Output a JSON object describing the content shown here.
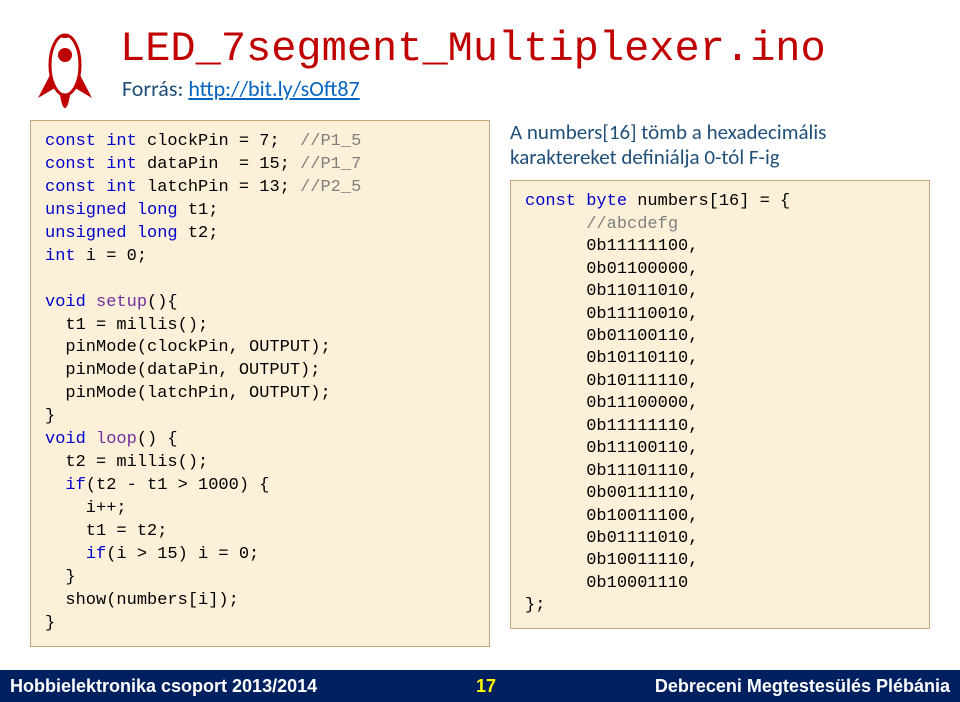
{
  "header": {
    "title": "LED_7segment_Multiplexer.ino",
    "source_label": "Forrás: ",
    "source_link": "http://bit.ly/sOft87"
  },
  "code_left": {
    "l1a": "const int",
    "l1b": " clockPin = 7;  ",
    "l1c": "//P1_5",
    "l2a": "const int",
    "l2b": " dataPin  = 15; ",
    "l2c": "//P1_7",
    "l3a": "const int",
    "l3b": " latchPin = 13; ",
    "l3c": "//P2_5",
    "l4a": "unsigned long",
    "l4b": " t1;",
    "l5a": "unsigned long",
    "l5b": " t2;",
    "l6a": "int",
    "l6b": " i = 0;",
    "l7": "",
    "l8a": "void",
    "l8b": " ",
    "l8c": "setup",
    "l8d": "(){",
    "l9": "  t1 = millis();",
    "l10": "  pinMode(clockPin, OUTPUT);",
    "l11": "  pinMode(dataPin, OUTPUT);",
    "l12": "  pinMode(latchPin, OUTPUT);",
    "l13": "}",
    "l14a": "void",
    "l14b": " ",
    "l14c": "loop",
    "l14d": "() {",
    "l15": "  t2 = millis();",
    "l16a": "  ",
    "l16b": "if",
    "l16c": "(t2 - t1 > 1000) {",
    "l17": "    i++;",
    "l18": "    t1 = t2;",
    "l19a": "    ",
    "l19b": "if",
    "l19c": "(i > 15) i = 0;",
    "l20": "  }",
    "l21": "  show(numbers[i]);",
    "l22": "}"
  },
  "right_note": "A numbers[16] tömb a hexadecimális karaktereket definiálja 0-tól F-ig",
  "code_right": {
    "r1a": "const byte",
    "r1b": " numbers[16] = {",
    "r2": "      //abcdefg",
    "r3": "      0b11111100,",
    "r4": "      0b01100000,",
    "r5": "      0b11011010,",
    "r6": "      0b11110010,",
    "r7": "      0b01100110,",
    "r8": "      0b10110110,",
    "r9": "      0b10111110,",
    "r10": "      0b11100000,",
    "r11": "      0b11111110,",
    "r12": "      0b11100110,",
    "r13": "      0b11101110,",
    "r14": "      0b00111110,",
    "r15": "      0b10011100,",
    "r16": "      0b01111010,",
    "r17": "      0b10011110,",
    "r18": "      0b10001110",
    "r19": "};"
  },
  "footer": {
    "left": "Hobbielektronika csoport 2013/2014",
    "center": "17",
    "right": "Debreceni Megtestesülés Plébánia"
  }
}
